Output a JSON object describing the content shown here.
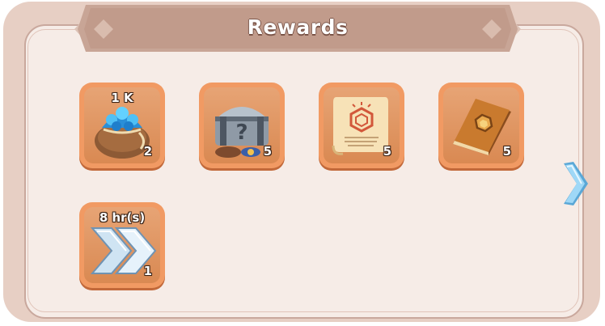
{
  "title": "Rewards",
  "colors": {
    "panel_outer": "#e7cfc4",
    "panel_inner": "#f6ece7",
    "banner": "#c8a596",
    "slot_border": "#f19a63",
    "slot_fill": "#d98952",
    "next_arrow": "#8ecdf0"
  },
  "rewards": [
    {
      "name": "gem-bag",
      "label": "1 K",
      "count": "2"
    },
    {
      "name": "mystery-chest",
      "label": "",
      "count": "5"
    },
    {
      "name": "scroll",
      "label": "",
      "count": "5"
    },
    {
      "name": "book",
      "label": "",
      "count": "5"
    },
    {
      "name": "speedup",
      "label": "8 hr(s)",
      "count": "1"
    }
  ],
  "navigation": {
    "next_icon": "chevron-right-icon"
  }
}
